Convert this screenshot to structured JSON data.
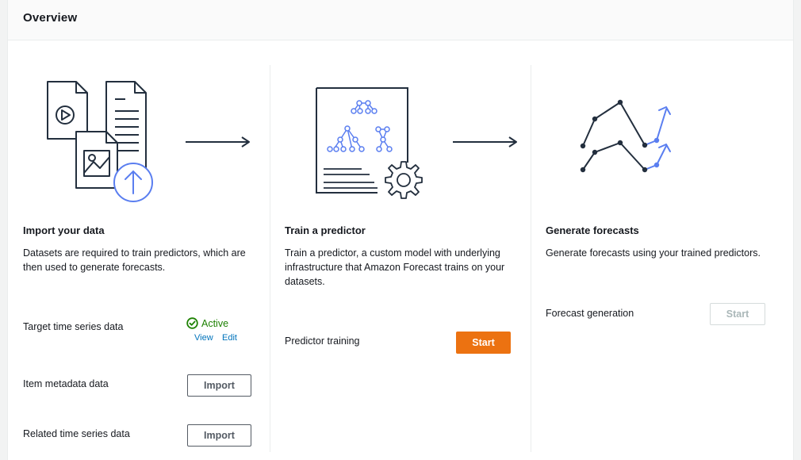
{
  "panel": {
    "title": "Overview"
  },
  "steps": [
    {
      "title": "Import your data",
      "description": "Datasets are required to train predictors, which are then used to generate forecasts.",
      "rows": [
        {
          "label": "Target time series data",
          "status": "Active",
          "links": [
            "View",
            "Edit"
          ]
        },
        {
          "label": "Item metadata data",
          "button": "Import"
        },
        {
          "label": "Related time series data",
          "button": "Import"
        }
      ]
    },
    {
      "title": "Train a predictor",
      "description": "Train a predictor, a custom model with underlying infrastructure that Amazon Forecast trains on your datasets.",
      "rows": [
        {
          "label": "Predictor training",
          "button": "Start"
        }
      ]
    },
    {
      "title": "Generate forecasts",
      "description": "Generate forecasts using your trained predictors.",
      "rows": [
        {
          "label": "Forecast generation",
          "button": "Start"
        }
      ]
    }
  ],
  "icons": {
    "import": "import-data-icon",
    "train": "train-predictor-icon",
    "forecast": "forecast-chart-icon",
    "arrow": "arrow-right-icon",
    "status": "check-circle-icon"
  },
  "colors": {
    "primary_button": "#ec7211",
    "status_green": "#1d8102",
    "link": "#0073bb",
    "illustration_blue": "#5a7ef0",
    "illustration_dark": "#232f3e"
  }
}
